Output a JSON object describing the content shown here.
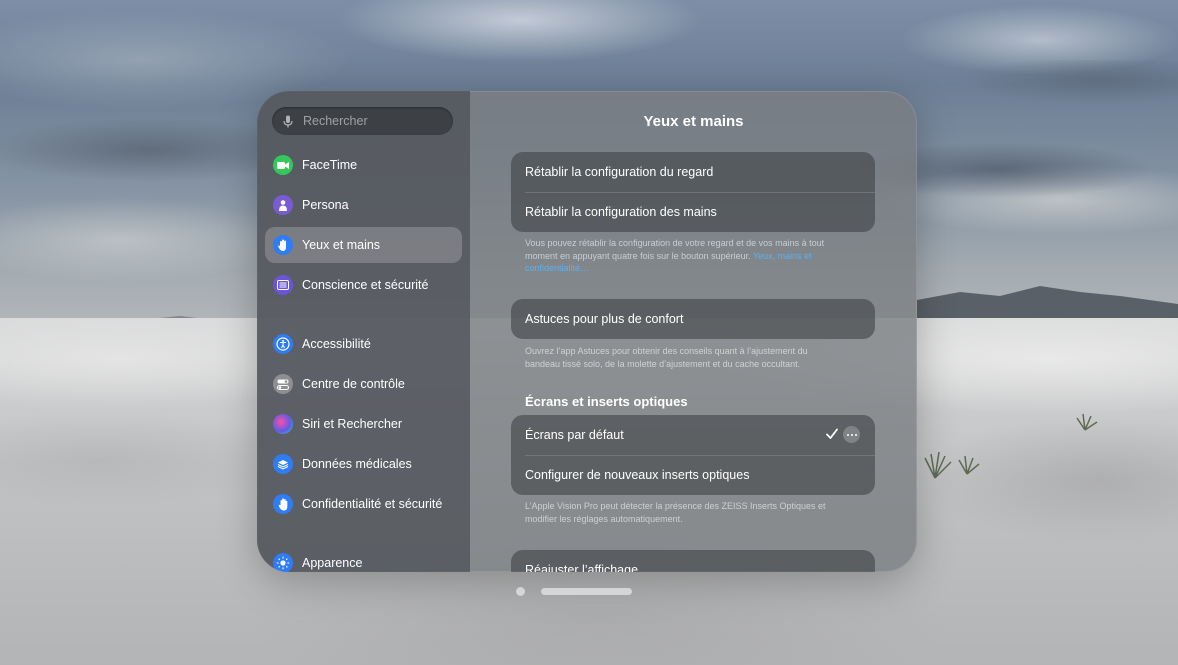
{
  "search": {
    "placeholder": "Rechercher"
  },
  "sidebar": {
    "items": [
      {
        "label": "FaceTime",
        "icon": "facetime-icon",
        "color": "#34c759"
      },
      {
        "label": "Persona",
        "icon": "persona-icon",
        "color": "#7a5bd6"
      },
      {
        "label": "Yeux et mains",
        "icon": "hand-eye-icon",
        "color": "#2f7df6",
        "selected": true
      },
      {
        "label": "Conscience et sécurité",
        "icon": "awareness-icon",
        "color": "#6a55d8"
      },
      {
        "label": "Accessibilité",
        "icon": "accessibility-icon",
        "color": "#2f7df6"
      },
      {
        "label": "Centre de contrôle",
        "icon": "control-center-icon",
        "color": "#8e8e93"
      },
      {
        "label": "Siri et Rechercher",
        "icon": "siri-icon",
        "color": "#5e5ce6"
      },
      {
        "label": "Données médicales",
        "icon": "health-data-icon",
        "color": "#2f7df6"
      },
      {
        "label": "Confidentialité et sécurité",
        "icon": "privacy-hand-icon",
        "color": "#2f7df6"
      },
      {
        "label": "Apparence",
        "icon": "appearance-icon",
        "color": "#2f7df6"
      }
    ]
  },
  "main": {
    "title": "Yeux et mains",
    "reset_group": {
      "rows": [
        "Rétablir la configuration du regard",
        "Rétablir la configuration des mains"
      ],
      "footnote": "Vous pouvez rétablir la configuration de votre regard et de vos mains à tout moment en appuyant quatre fois sur le bouton supérieur. ",
      "footnote_link": "Yeux, mains et confidentialité…"
    },
    "tips_group": {
      "row": "Astuces pour plus de confort",
      "footnote": "Ouvrez l’app Astuces pour obtenir des conseils quant à l’ajustement du bandeau tissé solo, de la molette d’ajustement et du cache occultant."
    },
    "optics": {
      "header": "Écrans et inserts optiques",
      "rows": [
        "Écrans par défaut",
        "Configurer de nouveaux inserts optiques"
      ],
      "footnote": "L’Apple Vision Pro peut détecter la présence des ZEISS Inserts Optiques et modifier les réglages automatiquement."
    },
    "display_group": {
      "row": "Réajuster l’affichage"
    }
  },
  "colors": {
    "accent": "#2f7df6",
    "link": "#5cb0f0"
  }
}
